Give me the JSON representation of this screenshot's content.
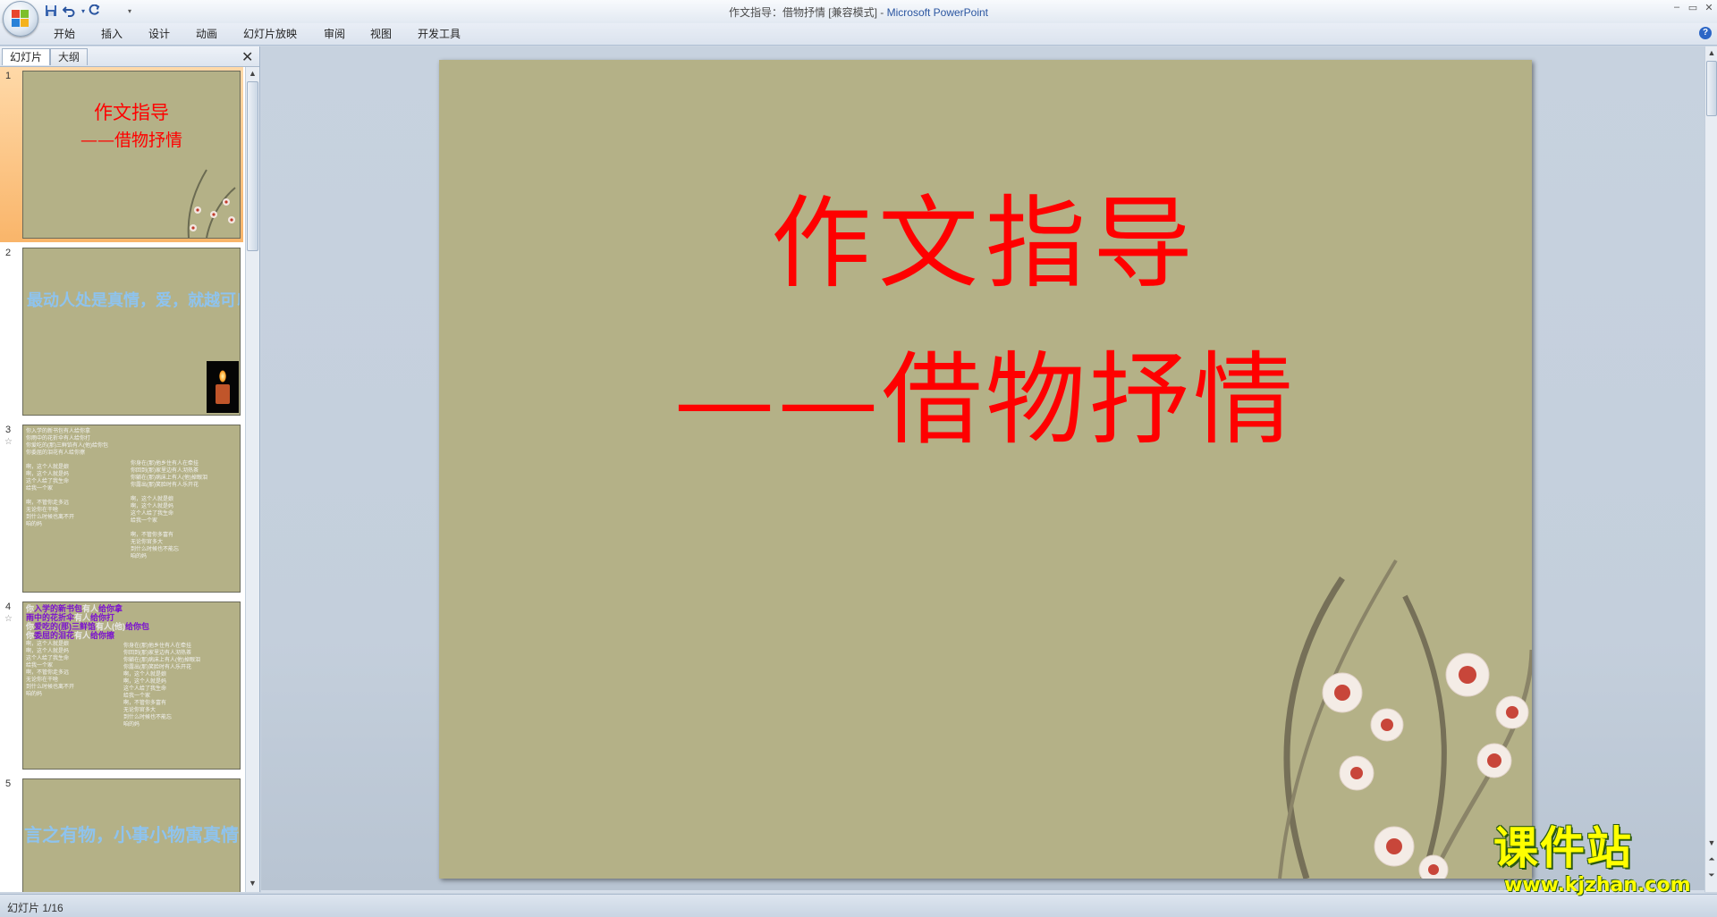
{
  "window": {
    "title_doc": "作文指导：借物抒情 [兼容模式] - ",
    "title_app": "Microsoft PowerPoint",
    "controls": [
      "–",
      "▭",
      "✕"
    ]
  },
  "quick_access": {
    "save_icon": "save-icon",
    "undo_icon": "undo-icon",
    "redo_icon": "redo-icon",
    "customize_icon": "customize-icon"
  },
  "ribbon": {
    "tabs": [
      "开始",
      "插入",
      "设计",
      "动画",
      "幻灯片放映",
      "审阅",
      "视图",
      "开发工具"
    ],
    "help": "?"
  },
  "left_panel": {
    "tab_slides": "幻灯片",
    "tab_outline": "大纲",
    "close": "✕",
    "thumbnails": [
      {
        "num": "1",
        "title": "作文指导",
        "subtitle": "——借物抒情"
      },
      {
        "num": "2",
        "text": "最动人处是真情，爱，就越可以常写常新。"
      },
      {
        "num": "3",
        "star": "☆",
        "lines_left": [
          "你入学的新书包有人给你拿",
          "你雨中的花折伞有人给你打",
          "你爱吃的(那)三鲜馅有人(他)给你包",
          "你委屈的泪花有人给你擦",
          "",
          "啊，这个人就是娘",
          "啊，这个人就是妈",
          "这个人给了我生命",
          "给我一个家",
          "",
          "啊，不管你走多远",
          "无论你在干啥",
          "到什么时候也离不开",
          "咱的妈"
        ],
        "lines_right": [
          "你身在(那)他乡住有人在牵挂",
          "你回到(那)家里边有人沏热茶",
          "你躺在(那)病床上有人(他)掉眼泪",
          "你露出(那)笑脸时有人乐开花",
          "",
          "啊，这个人就是娘",
          "啊，这个人就是妈",
          "这个人给了我生命",
          "给我一个家",
          "",
          "啊，不管你多富有",
          "无论你官多大",
          "到什么时候也不能忘",
          "咱的妈"
        ]
      },
      {
        "num": "4",
        "star": "☆",
        "hl_lines": [
          {
            "parts": [
              {
                "t": "你",
                "c": "#e8e8e8"
              },
              {
                "t": "入学的新书包",
                "c": "#7a10d0"
              },
              {
                "t": "有人",
                "c": "#e8e8e8"
              },
              {
                "t": "给你拿",
                "c": "#7a10d0"
              }
            ]
          },
          {
            "parts": [
              {
                "t": "雨中的花折伞",
                "c": "#7a10d0"
              },
              {
                "t": "有人",
                "c": "#e8e8e8"
              },
              {
                "t": "给你打",
                "c": "#7a10d0"
              }
            ]
          },
          {
            "parts": [
              {
                "t": "你",
                "c": "#e8e8e8"
              },
              {
                "t": "爱吃的(那)三鲜馅",
                "c": "#7a10d0"
              },
              {
                "t": "有人(他)",
                "c": "#e8e8e8"
              },
              {
                "t": "给你包",
                "c": "#7a10d0"
              }
            ]
          },
          {
            "parts": [
              {
                "t": "你",
                "c": "#e8e8e8"
              },
              {
                "t": "委屈的泪花",
                "c": "#7a10d0"
              },
              {
                "t": "有人",
                "c": "#e8e8e8"
              },
              {
                "t": "给你擦",
                "c": "#7a10d0"
              }
            ]
          }
        ],
        "lines_left": [
          "啊，这个人就是娘",
          "啊，这个人就是妈",
          "这个人给了我生命",
          "给我一个家",
          "啊，不管你走多远",
          "无论你在干啥",
          "到什么时候也离不开",
          "咱的妈"
        ],
        "lines_right": [
          "你身在(那)他乡住有人在牵挂",
          "你回到(那)家里边有人沏热茶",
          "你躺在(那)病床上有人(他)掉眼泪",
          "你露出(那)笑脸时有人乐开花",
          "啊，这个人就是娘",
          "啊，这个人就是妈",
          "这个人给了我生命",
          "给我一个家",
          "啊，不管你多富有",
          "无论你官多大",
          "到什么时候也不能忘",
          "咱的妈"
        ]
      },
      {
        "num": "5",
        "text": "言之有物，小事小物寓真情"
      }
    ]
  },
  "slide": {
    "title": "作文指导",
    "subtitle": "——借物抒情",
    "title_color": "#ff0000",
    "background": "#b4b187"
  },
  "status": {
    "text": "幻灯片 1/16"
  },
  "watermark": {
    "text": "课件站",
    "url": "www.kjzhan.com"
  }
}
